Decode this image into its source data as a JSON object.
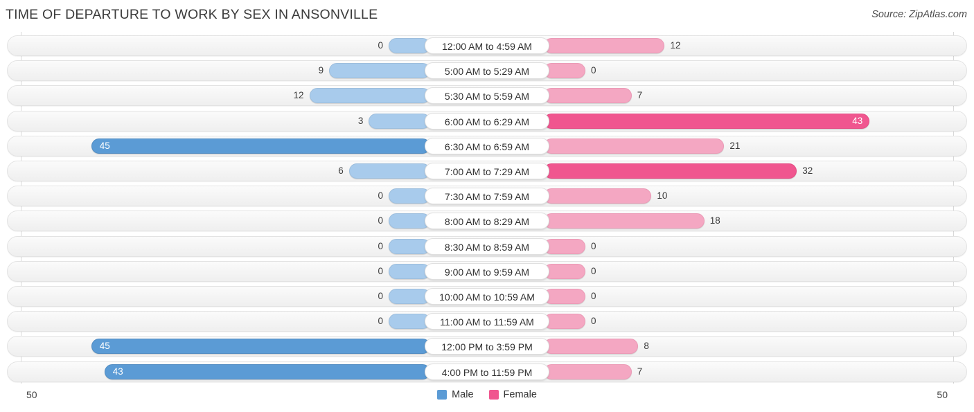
{
  "header": {
    "title": "TIME OF DEPARTURE TO WORK BY SEX IN ANSONVILLE",
    "source": "Source: ZipAtlas.com"
  },
  "axis": {
    "left_tick": "50",
    "right_tick": "50"
  },
  "legend": [
    {
      "label": "Male",
      "color": "#5b9bd5"
    },
    {
      "label": "Female",
      "color": "#f0568f"
    }
  ],
  "colors": {
    "male_light": "#a8cbec",
    "male_dark": "#5b9bd5",
    "female_light": "#f4a7c2",
    "female_dark": "#f0568f",
    "track": "#f4f4f4"
  },
  "chart_data": {
    "type": "bar",
    "title": "TIME OF DEPARTURE TO WORK BY SEX IN ANSONVILLE",
    "subtitle": "",
    "orientation": "horizontal-diverging",
    "xlabel": "",
    "ylabel": "",
    "xlim": [
      50,
      50
    ],
    "grid": false,
    "legend_position": "bottom-center",
    "categories": [
      "12:00 AM to 4:59 AM",
      "5:00 AM to 5:29 AM",
      "5:30 AM to 5:59 AM",
      "6:00 AM to 6:29 AM",
      "6:30 AM to 6:59 AM",
      "7:00 AM to 7:29 AM",
      "7:30 AM to 7:59 AM",
      "8:00 AM to 8:29 AM",
      "8:30 AM to 8:59 AM",
      "9:00 AM to 9:59 AM",
      "10:00 AM to 10:59 AM",
      "11:00 AM to 11:59 AM",
      "12:00 PM to 3:59 PM",
      "4:00 PM to 11:59 PM"
    ],
    "series": [
      {
        "name": "Male",
        "values": [
          0,
          9,
          12,
          3,
          45,
          6,
          0,
          0,
          0,
          0,
          0,
          0,
          45,
          43
        ]
      },
      {
        "name": "Female",
        "values": [
          12,
          0,
          7,
          43,
          21,
          32,
          10,
          18,
          0,
          0,
          0,
          0,
          8,
          7
        ]
      }
    ]
  }
}
